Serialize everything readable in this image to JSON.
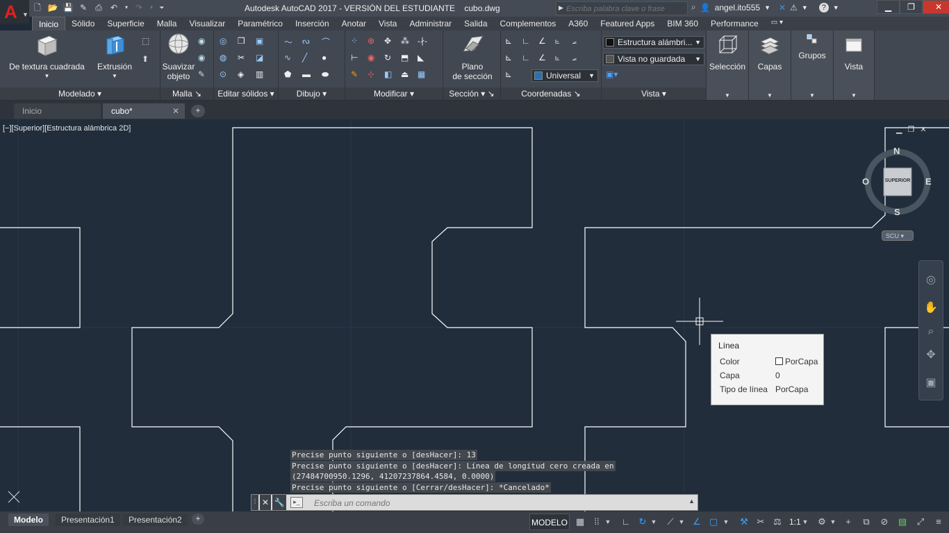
{
  "title_bar": {
    "title": "Autodesk AutoCAD 2017 - VERSIÓN DEL ESTUDIANTE    cubo.dwg",
    "search_placeholder": "Escriba palabra clave o frase",
    "username": "angel.ito555"
  },
  "ribbon_tabs": [
    "Inicio",
    "Sólido",
    "Superficie",
    "Malla",
    "Visualizar",
    "Paramétrico",
    "Inserción",
    "Anotar",
    "Vista",
    "Administrar",
    "Salida",
    "Complementos",
    "A360",
    "Featured Apps",
    "BIM 360",
    "Performance"
  ],
  "ribbon": {
    "panels": {
      "modelado": "Modelado",
      "malla": "Malla",
      "editar_solidos": "Editar sólidos",
      "dibujo": "Dibujo",
      "modificar": "Modificar",
      "seccion": "Sección",
      "coordenadas": "Coordenadas",
      "vista": "Vista"
    },
    "buttons": {
      "textura_cuadrada": "De textura cuadrada",
      "extrusion": "Extrusión",
      "suavizar_1": "Suavizar",
      "suavizar_2": "objeto",
      "plano_1": "Plano",
      "plano_2": "de sección",
      "seleccion": "Selección",
      "capas": "Capas",
      "grupos": "Grupos",
      "vista": "Vista"
    },
    "dropdowns": {
      "visual_style": "Estructura alámbri...",
      "named_view": "Vista no guardada",
      "ucs": "Universal"
    }
  },
  "doc_tabs": {
    "inicio": "Inicio",
    "cubo": "cubo*"
  },
  "viewport": {
    "label": "[−][Superior][Estructura alámbrica 2D]",
    "viewcube": {
      "n": "N",
      "s": "S",
      "e": "E",
      "w": "O",
      "face": "SUPERIOR"
    },
    "ucs_button": "SCU"
  },
  "tooltip": {
    "title": "Línea",
    "rows": [
      {
        "label": "Color",
        "value": "PorCapa"
      },
      {
        "label": "Capa",
        "value": "0"
      },
      {
        "label": "Tipo de línea",
        "value": "PorCapa"
      }
    ]
  },
  "command_history": [
    "Precise punto siguiente o [desHacer]: 13",
    "Precise punto siguiente o [desHacer]: Línea de longitud cero creada en",
    "(27484700950.1296, 41207237864.4584, 0.0000)",
    "Precise punto siguiente o [Cerrar/desHacer]: *Cancelado*"
  ],
  "command_input": {
    "placeholder": "Escriba un comando"
  },
  "layout_tabs": [
    "Modelo",
    "Presentación1",
    "Presentación2"
  ],
  "status_bar": {
    "model_label": "MODELO",
    "scale": "1:1"
  }
}
